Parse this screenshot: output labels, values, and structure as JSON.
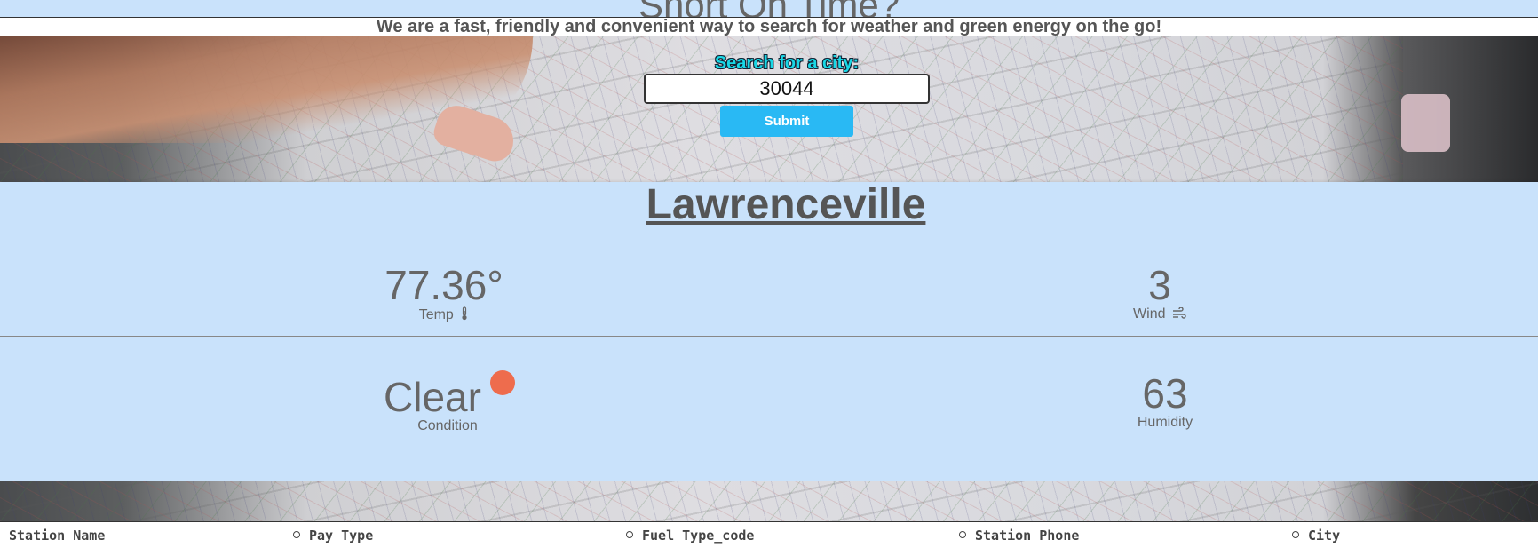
{
  "header": {
    "title": "Short On Time?",
    "tagline": "We are a fast, friendly and convenient way to search for weather and green energy on the go!"
  },
  "search": {
    "label": "Search for a city:",
    "value": "30044",
    "submit_label": "Submit"
  },
  "weather": {
    "city": "Lawrenceville",
    "temp": "77.36°",
    "temp_label": "Temp",
    "wind": "3",
    "wind_label": "Wind",
    "condition": "Clear",
    "condition_label": "Condition",
    "humidity": "63",
    "humidity_label": "Humidity"
  },
  "stations": {
    "columns": [
      "Station Name",
      "Pay Type",
      "Fuel Type_code",
      "Station Phone",
      "City"
    ]
  },
  "colors": {
    "panel": "#c9e2fb",
    "accent_button": "#29b9f4",
    "search_label": "#19d8e6",
    "sun": "#ee6c4d"
  }
}
